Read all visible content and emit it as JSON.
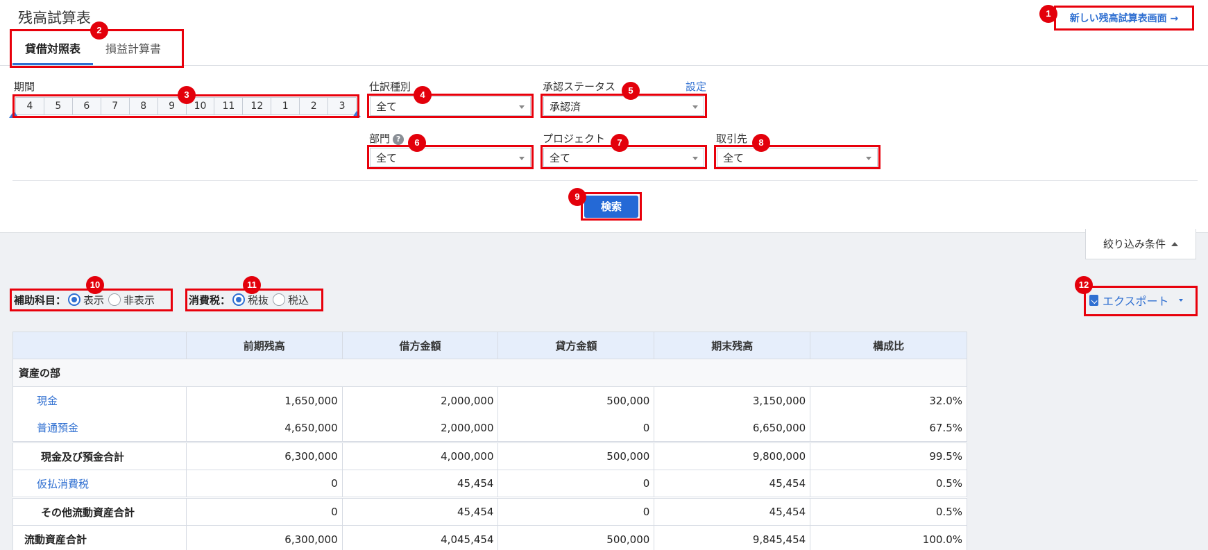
{
  "page": {
    "title": "残高試算表",
    "new_screen_link": "新しい残高試算表画面 →"
  },
  "tabs": [
    {
      "label": "貸借対照表",
      "active": true
    },
    {
      "label": "損益計算書",
      "active": false
    }
  ],
  "filters": {
    "period_label": "期間",
    "months": [
      "4",
      "5",
      "6",
      "7",
      "8",
      "9",
      "10",
      "11",
      "12",
      "1",
      "2",
      "3"
    ],
    "journal_type": {
      "label": "仕訳種別",
      "value": "全て"
    },
    "approval_status": {
      "label": "承認ステータス",
      "value": "承認済",
      "settings_link": "設定"
    },
    "department": {
      "label": "部門",
      "help": "?",
      "value": "全て"
    },
    "project": {
      "label": "プロジェクト",
      "value": "全て"
    },
    "partner": {
      "label": "取引先",
      "value": "全て"
    },
    "search_button": "検索",
    "filter_toggle": "絞り込み条件"
  },
  "options": {
    "sub_account": {
      "label": "補助科目：",
      "options": [
        "表示",
        "非表示"
      ],
      "selected": "表示"
    },
    "tax": {
      "label": "消費税：",
      "options": [
        "税抜",
        "税込"
      ],
      "selected": "税抜"
    },
    "export": "エクスポート"
  },
  "table": {
    "headers": [
      "",
      "前期残高",
      "借方金額",
      "貸方金額",
      "期末残高",
      "構成比"
    ],
    "section": "資産の部",
    "rows": [
      {
        "name": "現金",
        "values": [
          "1,650,000",
          "2,000,000",
          "500,000",
          "3,150,000",
          "32.0%"
        ]
      },
      {
        "name": "普通預金",
        "values": [
          "4,650,000",
          "2,000,000",
          "0",
          "6,650,000",
          "67.5%"
        ]
      },
      {
        "name": "現金及び預金合計",
        "values": [
          "6,300,000",
          "4,000,000",
          "500,000",
          "9,800,000",
          "99.5%"
        ]
      },
      {
        "name": "仮払消費税",
        "values": [
          "0",
          "45,454",
          "0",
          "45,454",
          "0.5%"
        ]
      },
      {
        "name": "その他流動資産合計",
        "values": [
          "0",
          "45,454",
          "0",
          "45,454",
          "0.5%"
        ]
      },
      {
        "name": "流動資産合計",
        "values": [
          "6,300,000",
          "4,045,454",
          "500,000",
          "9,845,454",
          "100.0%"
        ]
      }
    ]
  },
  "annotations": [
    "1",
    "2",
    "3",
    "4",
    "5",
    "6",
    "7",
    "8",
    "9",
    "10",
    "11",
    "12"
  ],
  "colors": {
    "accent": "#2f6fd1",
    "highlight": "#e8000b",
    "header_bg": "#e6eefb"
  }
}
